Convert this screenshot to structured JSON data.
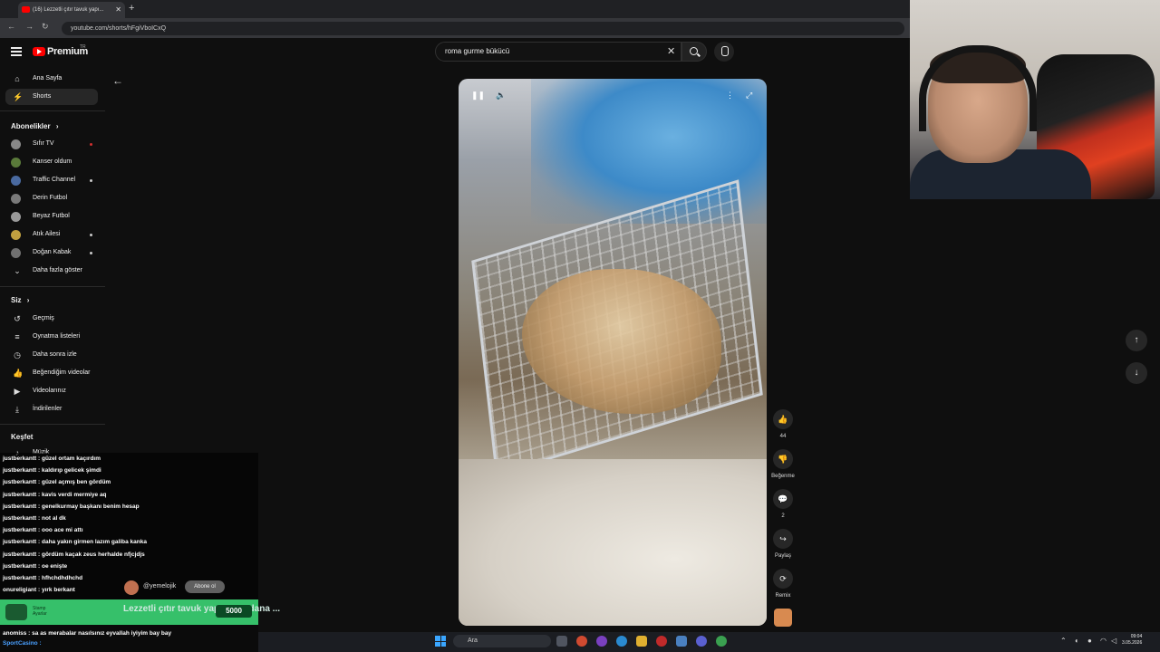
{
  "browser": {
    "tab_title": "(16) Lezzetli çıtır tavuk yapı...",
    "tab_close": "✕",
    "new_tab": "+",
    "url": "youtube.com/shorts/hFgiVboICxQ",
    "nav": {
      "back": "←",
      "forward": "→",
      "reload": "↻"
    }
  },
  "header": {
    "logo_text": "Premium",
    "tm": "TR",
    "search_value": "roma gurme bükücü",
    "clear_icon": "✕"
  },
  "sidebar": {
    "main": [
      {
        "label": "Ana Sayfa",
        "icon": "⌂"
      },
      {
        "label": "Shorts",
        "icon": "⚡"
      }
    ],
    "subs_title": "Abonelikler",
    "subs_chevron": "›",
    "subscriptions": [
      {
        "label": "Sıfır TV",
        "color": "#888888",
        "live": true
      },
      {
        "label": "Kanser oldum",
        "color": "#5a7a3a",
        "live": false
      },
      {
        "label": "Traffic Channel",
        "color": "#4a6aa0",
        "live": true
      },
      {
        "label": "Derin Futbol",
        "color": "#7a7a7a",
        "live": false
      },
      {
        "label": "Beyaz Futbol",
        "color": "#9a9a9a",
        "live": false
      },
      {
        "label": "Atık Ailesi",
        "color": "#c0a040",
        "live": true
      },
      {
        "label": "Doğan Kabak",
        "color": "#707070",
        "live": true
      }
    ],
    "show_more": "Daha fazla göster",
    "show_more_icon": "⌄",
    "you_title": "Siz",
    "you_chevron": "›",
    "you": [
      {
        "label": "Geçmiş",
        "icon": "↺"
      },
      {
        "label": "Oynatma listeleri",
        "icon": "≡"
      },
      {
        "label": "Daha sonra izle",
        "icon": "◷"
      },
      {
        "label": "Beğendiğim videolar",
        "icon": "👍"
      },
      {
        "label": "Videolarınız",
        "icon": "▶"
      },
      {
        "label": "İndirilenler",
        "icon": "⤓"
      }
    ],
    "explore_title": "Keşfet",
    "explore": [
      {
        "label": "Müzik",
        "icon": "♪"
      }
    ]
  },
  "video_controls": {
    "pause": "❚❚",
    "volume": "🔈",
    "more": "⋮",
    "fullscreen": "⤢"
  },
  "actions": {
    "like_icon": "👍",
    "like_count": "44",
    "dislike_icon": "👎",
    "dislike_label": "Beğenme",
    "comment_icon": "💬",
    "comment_count": "2",
    "share_icon": "↪",
    "share_label": "Paylaş",
    "remix_icon": "⟳",
    "remix_label": "Remix"
  },
  "shorts_nav": {
    "up": "↑",
    "down": "↓"
  },
  "chat": [
    {
      "user": "justberkantt",
      "msg": "güzel ortam kaçırdım"
    },
    {
      "user": "justberkantt",
      "msg": "kaldırıp gelicek şimdi"
    },
    {
      "user": "justberkantt",
      "msg": "güzel açmış ben gördüm"
    },
    {
      "user": "justberkantt",
      "msg": "kavis verdi mermiye aq"
    },
    {
      "user": "justberkantt",
      "msg": "genelkurmay başkanı benim hesap"
    },
    {
      "user": "justberkantt",
      "msg": "not al dk"
    },
    {
      "user": "justberkantt",
      "msg": "ooo ace mi attı"
    },
    {
      "user": "justberkantt",
      "msg": "daha yakın girmen lazım galiba kanka"
    },
    {
      "user": "justberkantt",
      "msg": "gördüm kaçak zeus herhalde nfjcjdjs"
    },
    {
      "user": "justberkantt",
      "msg": "oe enişte"
    },
    {
      "user": "justberkantt",
      "msg": "hfhchdhdhchd"
    },
    {
      "user": "onureligiant",
      "msg": "yırk berkant"
    }
  ],
  "channel_row": {
    "name": "@yemelojik",
    "subscribe": "Abone ol"
  },
  "sub_card": {
    "name_line1": "Stamp",
    "name_line2": "Ayarlar",
    "title": "Lezzetli çıtır tavuk yapı... m Adana ...",
    "price": "5000"
  },
  "chat2": [
    {
      "user": "anomiss",
      "msg": "sa as merabalar nasılsınız eyvallah iyiyim bay bay",
      "color": "#ffffff"
    },
    {
      "user": "SportCasino",
      "msg": "",
      "color": "#4aa0ff"
    }
  ],
  "taskbar": {
    "search_placeholder": "Ara",
    "time": "09:04",
    "date": "3.05.2026",
    "tray_up": "⌃"
  },
  "colors": {
    "yt_red": "#ff0000",
    "sub_green": "#36c06a",
    "bg": "#0f0f0f"
  }
}
